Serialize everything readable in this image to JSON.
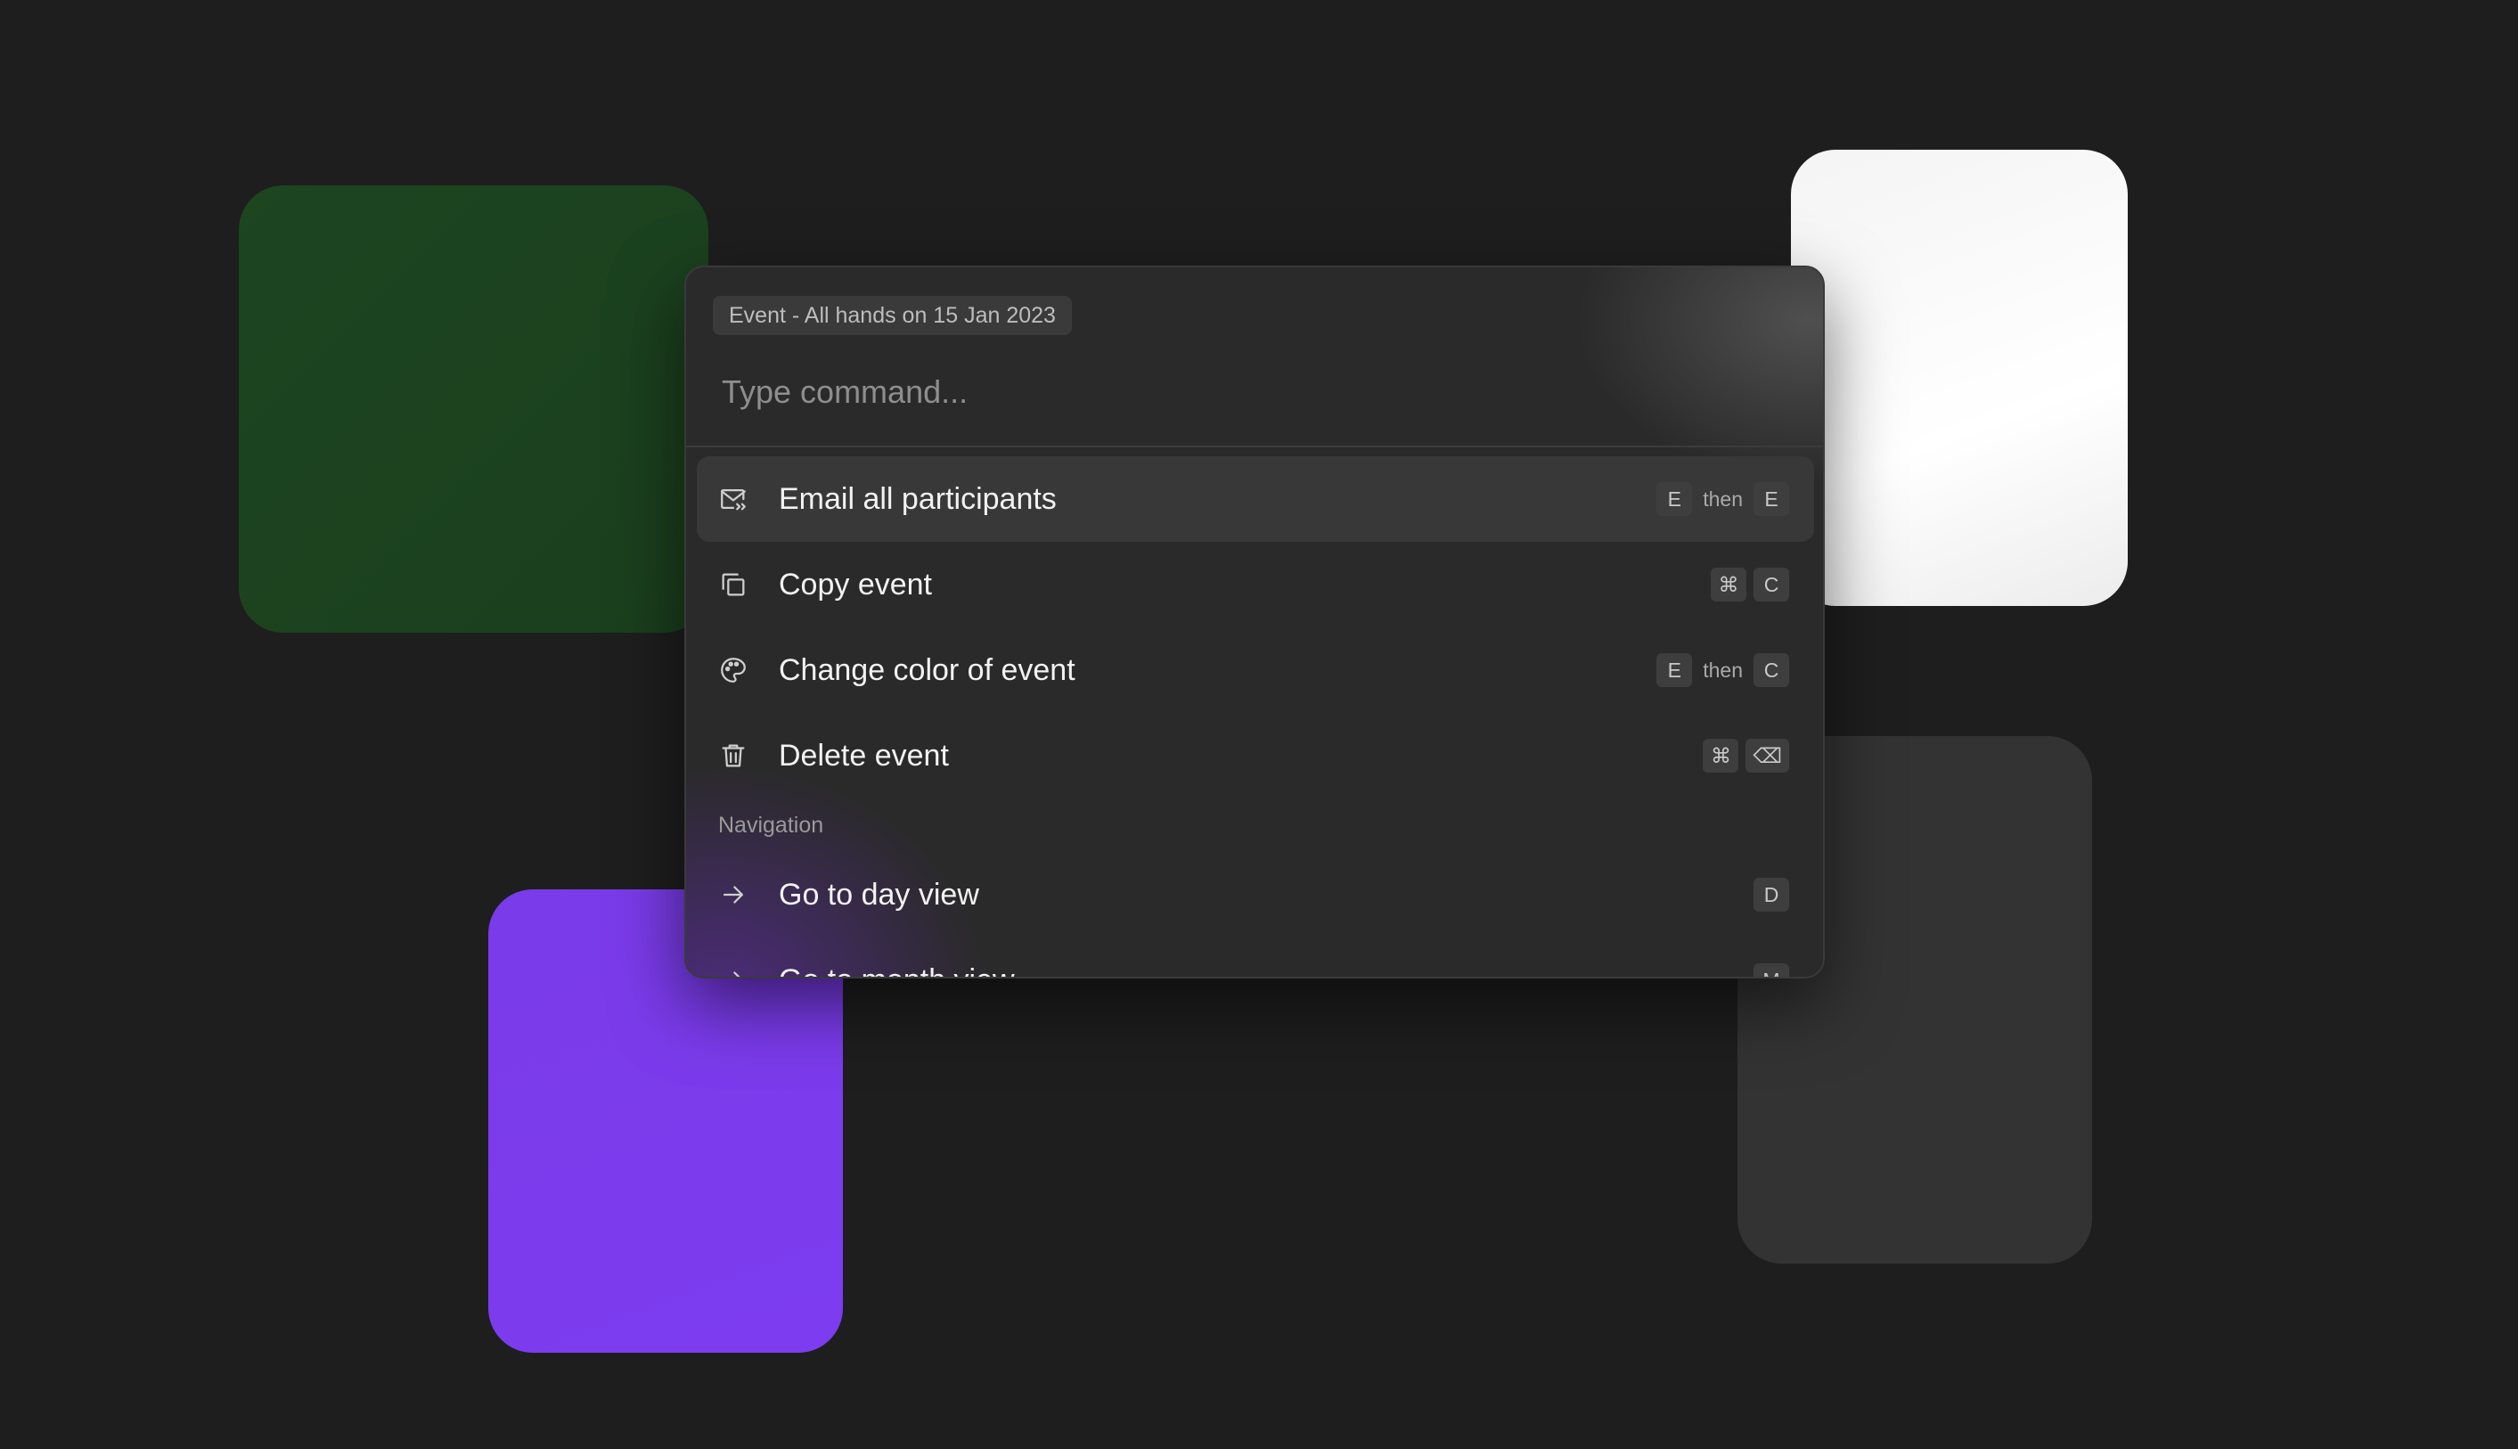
{
  "palette": {
    "context": "Event - All hands on 15 Jan 2023",
    "input_placeholder": "Type command...",
    "items": [
      {
        "label": "Email all participants",
        "icon": "mail-forward-icon",
        "keys": [
          "E",
          "then",
          "E"
        ],
        "active": true
      },
      {
        "label": "Copy event",
        "icon": "copy-icon",
        "keys": [
          "⌘",
          "C"
        ]
      },
      {
        "label": "Change color of event",
        "icon": "palette-icon",
        "keys": [
          "E",
          "then",
          "C"
        ]
      },
      {
        "label": "Delete event",
        "icon": "trash-icon",
        "keys": [
          "⌘",
          "⌫"
        ]
      }
    ],
    "sections": {
      "navigation": "Navigation"
    },
    "nav_items": [
      {
        "label": "Go to day view",
        "icon": "arrow-right-icon",
        "keys": [
          "D"
        ]
      },
      {
        "label": "Go to month view",
        "icon": "arrow-right-icon",
        "keys": [
          "M"
        ]
      }
    ]
  },
  "colors": {
    "background": "#1e1e1e",
    "green_card": "#1b421e",
    "white_card": "#ffffff",
    "purple_card": "#7c3aed",
    "gray_card": "#333333",
    "palette_bg": "#2a2a2a"
  }
}
